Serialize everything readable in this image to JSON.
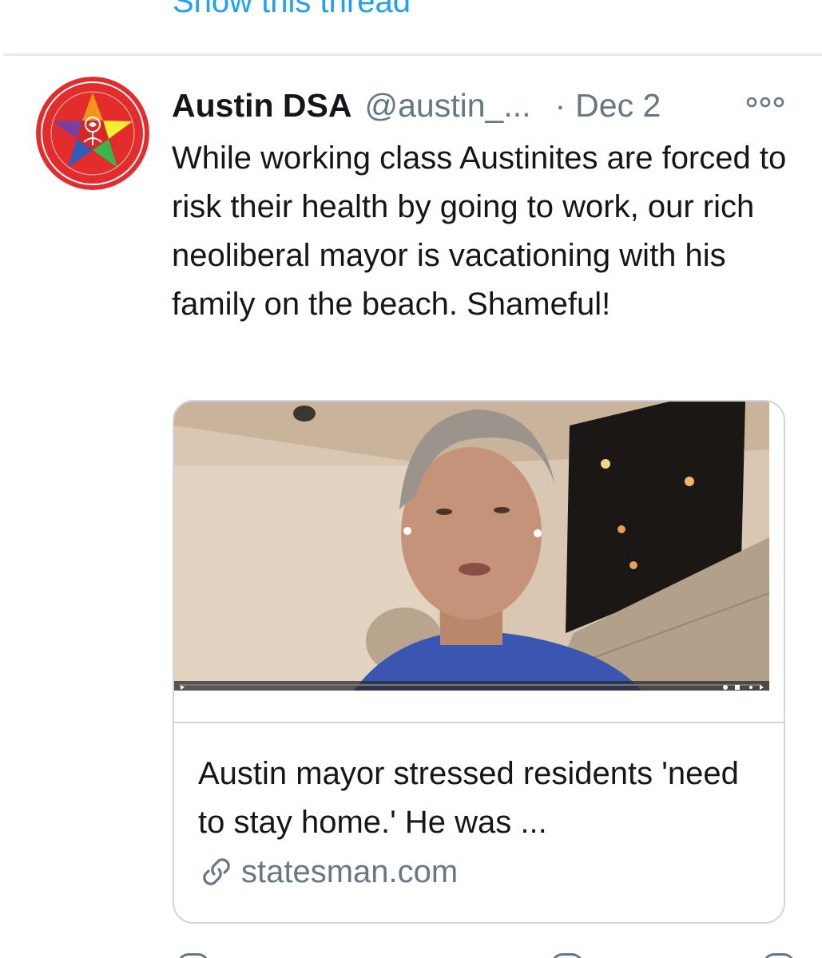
{
  "thread": {
    "show_label": "Show this thread"
  },
  "tweet": {
    "author": {
      "display_name": "Austin DSA",
      "handle": "@austin_...",
      "avatar_icon": "dsa-rose-star-avatar-icon"
    },
    "separator_dot": "·",
    "date": "Dec 2",
    "more_icon": "more-options-icon",
    "text": "While working class Austinites are forced to risk their health by going to work, our rich neoliberal mayor is vacationing with his family on the beach. Shameful!",
    "card": {
      "media_description_icon": "video-thumbnail",
      "title": "Austin mayor stressed residents 'need to stay home.' He was ...",
      "domain": "statesman.com",
      "link_icon": "link-icon"
    }
  },
  "colors": {
    "accent": "#1da1f2",
    "text_primary": "#14171a",
    "text_secondary": "#657786",
    "border": "#ccd6dd"
  }
}
